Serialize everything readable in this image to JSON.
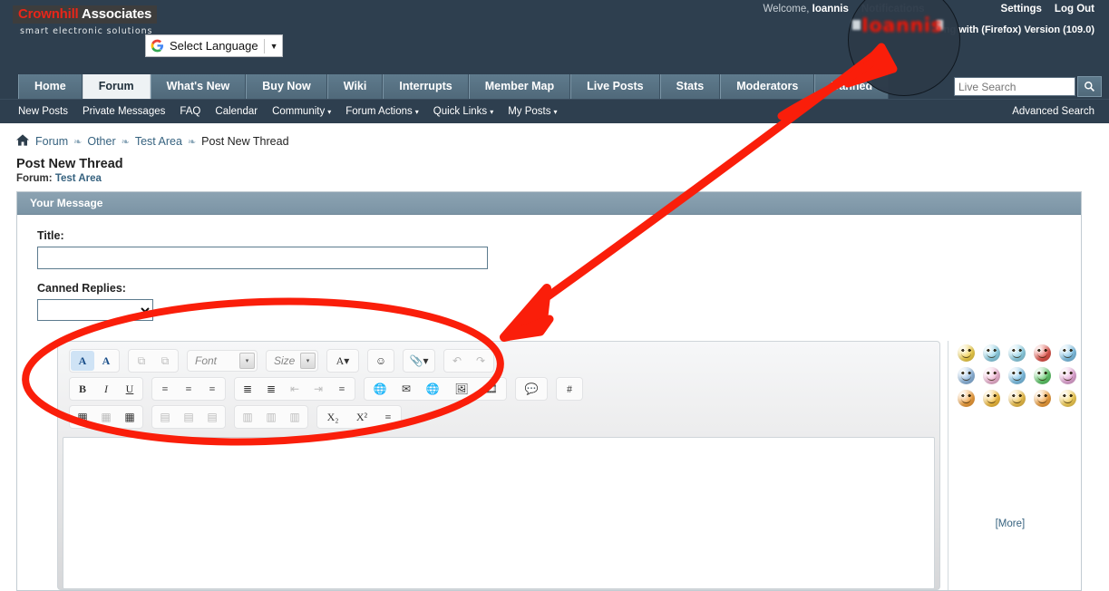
{
  "header": {
    "logo_primary": "Crownhill",
    "logo_secondary": "Associates",
    "tagline": "smart electronic solutions",
    "language_label": "Select Language",
    "language_caret": "▼",
    "welcome_prefix": "Welcome,",
    "username": "Ioannis",
    "notifications_label": "Notifications",
    "settings_label": "Settings",
    "logout_label": "Log Out",
    "browser_line": "ng with (Firefox) Version (109.0)",
    "redacted_name": "Ioannis"
  },
  "nav": {
    "tabs": [
      {
        "label": "Home",
        "active": false
      },
      {
        "label": "Forum",
        "active": true
      },
      {
        "label": "What's New",
        "active": false
      },
      {
        "label": "Buy Now",
        "active": false
      },
      {
        "label": "Wiki",
        "active": false
      },
      {
        "label": "Interrupts",
        "active": false
      },
      {
        "label": "Member Map",
        "active": false
      },
      {
        "label": "Live Posts",
        "active": false
      },
      {
        "label": "Stats",
        "active": false
      },
      {
        "label": "Moderators",
        "active": false
      },
      {
        "label": "Banned",
        "active": false
      }
    ],
    "search_placeholder": "Live Search",
    "search_icon": "🔍",
    "advanced_search": "Advanced Search",
    "sub_items": [
      {
        "label": "New Posts",
        "caret": false
      },
      {
        "label": "Private Messages",
        "caret": false
      },
      {
        "label": "FAQ",
        "caret": false
      },
      {
        "label": "Calendar",
        "caret": false
      },
      {
        "label": "Community",
        "caret": true
      },
      {
        "label": "Forum Actions",
        "caret": true
      },
      {
        "label": "Quick Links",
        "caret": true
      },
      {
        "label": "My Posts",
        "caret": true
      }
    ],
    "caret_glyph": "▾"
  },
  "breadcrumb": {
    "home_icon": "⌂",
    "items": [
      "Forum",
      "Other",
      "Test Area"
    ],
    "current": "Post New Thread",
    "separator": "❧"
  },
  "page": {
    "title": "Post New Thread",
    "forum_prefix": "Forum:",
    "forum_name": "Test Area"
  },
  "form": {
    "panel_title": "Your Message",
    "title_label": "Title:",
    "title_value": "",
    "canned_label": "Canned Replies:",
    "canned_value": ""
  },
  "editor": {
    "font_placeholder": "Font",
    "size_placeholder": "Size",
    "caret_glyph": "▾",
    "toolbar_rows": [
      {
        "groups": [
          {
            "buttons": [
              {
                "name": "remove-text-color-icon",
                "glyph": "A",
                "disabled": false
              },
              {
                "name": "remove-formatting-icon",
                "glyph": "A",
                "disabled": false
              }
            ]
          },
          {
            "buttons": [
              {
                "name": "paste-icon",
                "glyph": "⧉",
                "disabled": true
              },
              {
                "name": "paste-from-word-icon",
                "glyph": "⧉",
                "disabled": true
              }
            ]
          },
          {
            "select": "font"
          },
          {
            "select": "size"
          },
          {
            "buttons": [
              {
                "name": "font-color-icon",
                "glyph": "A▾",
                "disabled": false
              }
            ]
          },
          {
            "buttons": [
              {
                "name": "smilies-icon",
                "glyph": "☺",
                "disabled": false
              }
            ]
          },
          {
            "buttons": [
              {
                "name": "attachment-icon",
                "glyph": "📎▾",
                "disabled": false
              }
            ]
          },
          {
            "buttons": [
              {
                "name": "undo-icon",
                "glyph": "↶",
                "disabled": true
              },
              {
                "name": "redo-icon",
                "glyph": "↷",
                "disabled": true
              }
            ]
          }
        ]
      },
      {
        "groups": [
          {
            "buttons": [
              {
                "name": "bold-icon",
                "glyph": "B",
                "disabled": false
              },
              {
                "name": "italic-icon",
                "glyph": "I",
                "disabled": false
              },
              {
                "name": "underline-icon",
                "glyph": "U",
                "disabled": false
              }
            ]
          },
          {
            "buttons": [
              {
                "name": "align-left-icon",
                "glyph": "≡",
                "disabled": false
              },
              {
                "name": "align-center-icon",
                "glyph": "≡",
                "disabled": false
              },
              {
                "name": "align-right-icon",
                "glyph": "≡",
                "disabled": false
              }
            ]
          },
          {
            "buttons": [
              {
                "name": "ordered-list-icon",
                "glyph": "≣",
                "disabled": false
              },
              {
                "name": "bullet-list-icon",
                "glyph": "≣",
                "disabled": false
              },
              {
                "name": "outdent-icon",
                "glyph": "⇤",
                "disabled": true
              },
              {
                "name": "indent-icon",
                "glyph": "⇥",
                "disabled": true
              },
              {
                "name": "justify-icon",
                "glyph": "≡",
                "disabled": false
              }
            ]
          },
          {
            "buttons": [
              {
                "name": "insert-link-icon",
                "glyph": "🌐",
                "disabled": false
              },
              {
                "name": "insert-email-icon",
                "glyph": "✉",
                "disabled": false
              },
              {
                "name": "remove-link-icon",
                "glyph": "🌐",
                "disabled": false
              },
              {
                "name": "insert-image-icon",
                "glyph": "🖼",
                "disabled": false
              },
              {
                "name": "insert-video-icon",
                "glyph": "🎞",
                "disabled": false
              }
            ]
          },
          {
            "buttons": [
              {
                "name": "quote-icon",
                "glyph": "💬",
                "disabled": false
              }
            ]
          },
          {
            "buttons": [
              {
                "name": "code-hash-icon",
                "glyph": "#",
                "disabled": false
              }
            ]
          }
        ]
      },
      {
        "groups": [
          {
            "buttons": [
              {
                "name": "insert-table-icon",
                "glyph": "▦",
                "disabled": false
              },
              {
                "name": "table-properties-icon",
                "glyph": "▦",
                "disabled": true
              },
              {
                "name": "delete-table-icon",
                "glyph": "▦",
                "disabled": false
              }
            ]
          },
          {
            "buttons": [
              {
                "name": "insert-column-left-icon",
                "glyph": "▤",
                "disabled": true
              },
              {
                "name": "insert-column-right-icon",
                "glyph": "▤",
                "disabled": true
              },
              {
                "name": "delete-column-icon",
                "glyph": "▤",
                "disabled": true
              }
            ]
          },
          {
            "buttons": [
              {
                "name": "insert-row-above-icon",
                "glyph": "▥",
                "disabled": true
              },
              {
                "name": "insert-row-below-icon",
                "glyph": "▥",
                "disabled": true
              },
              {
                "name": "delete-row-icon",
                "glyph": "▥",
                "disabled": true
              }
            ]
          },
          {
            "buttons": [
              {
                "name": "subscript-icon",
                "glyph": "X₂",
                "disabled": false
              },
              {
                "name": "superscript-icon",
                "glyph": "X²",
                "disabled": false
              },
              {
                "name": "horizontal-rule-icon",
                "glyph": "≡",
                "disabled": false
              }
            ]
          }
        ]
      }
    ],
    "more_label": "[More]",
    "smilies": [
      "#f2d14a",
      "#8fd3e8",
      "#8fd3e8",
      "#e2534a",
      "#7fc3e8",
      "#8fb8e0",
      "#f2b7d6",
      "#7fc3e8",
      "#5fc96a",
      "#e6a8d8",
      "#f2a03c",
      "#f5bf3f",
      "#f0c24a",
      "#f2a03c",
      "#f5cf53"
    ]
  },
  "colors": {
    "header_bg": "#2e3f4f",
    "nav_tab": "#5f7b8d",
    "panel_head": "#8ca3b2",
    "link": "#36627f",
    "annotation_red": "#fa1e0a",
    "logo_red": "#e8261a"
  }
}
